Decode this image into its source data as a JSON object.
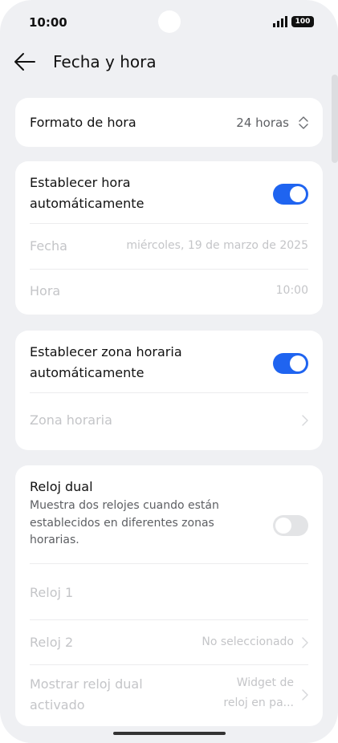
{
  "status_bar": {
    "time": "10:00",
    "battery": "100",
    "signal_icon": "signal-icon"
  },
  "header": {
    "title": "Fecha y hora",
    "back_icon": "arrow-left-icon"
  },
  "format": {
    "label": "Formato de hora",
    "value": "24 horas",
    "icon": "updown-chevron-icon"
  },
  "auto_time": {
    "label_line1": "Establecer hora",
    "label_line2": "automáticamente",
    "toggle": true,
    "date_label": "Fecha",
    "date_value": "miércoles, 19 de marzo de 2025",
    "time_label": "Hora",
    "time_value": "10:00"
  },
  "auto_zone": {
    "label_line1": "Establecer zona horaria",
    "label_line2": "automáticamente",
    "toggle": true,
    "zone_label": "Zona horaria"
  },
  "dual_clock": {
    "label": "Reloj dual",
    "desc_line1": "Muestra dos relojes cuando están",
    "desc_line2": "establecidos en diferentes zonas",
    "desc_line3": "horarias.",
    "toggle": false,
    "clock1_label": "Reloj 1",
    "clock2_label": "Reloj 2",
    "clock2_value": "No seleccionado",
    "show_label_line1": "Mostrar reloj dual",
    "show_label_line2": "activado",
    "show_value_line1": "Widget de",
    "show_value_line2": "reloj en pa..."
  },
  "colors": {
    "accent": "#1f64f0",
    "background": "#eff0f3",
    "card": "#ffffff"
  }
}
